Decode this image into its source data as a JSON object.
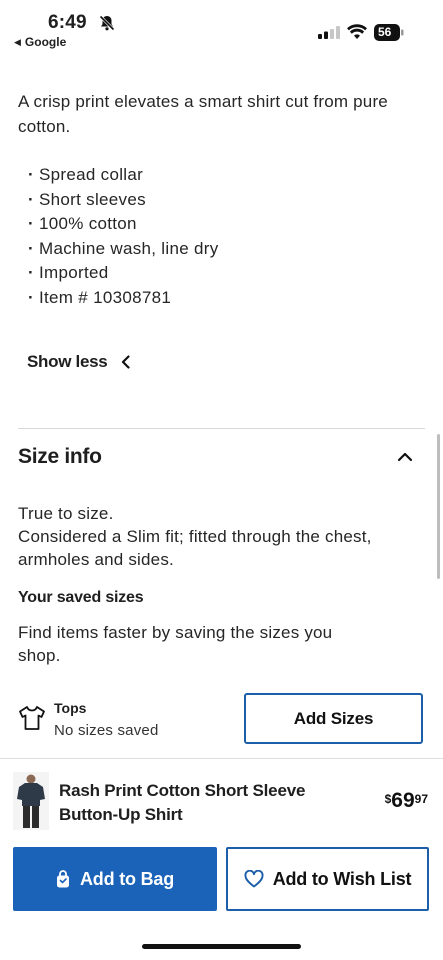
{
  "status_bar": {
    "time": "6:49",
    "back_app": "Google",
    "battery": "56"
  },
  "description": {
    "text": "A crisp print elevates a smart shirt cut from pure cotton.",
    "bullets": [
      "Spread collar",
      "Short sleeves",
      "100% cotton",
      "Machine wash, line dry",
      "Imported",
      "Item # 10308781"
    ],
    "show_less_label": "Show less"
  },
  "size_info": {
    "title": "Size info",
    "fit_line1": "True to size.",
    "fit_line2": "Considered a Slim fit; fitted through the chest, armholes and sides.",
    "saved_title": "Your saved sizes",
    "saved_desc": "Find items faster by saving the sizes you shop.",
    "category_label": "Tops",
    "category_status": "No sizes saved",
    "add_sizes_label": "Add Sizes"
  },
  "product_bar": {
    "name": "Rash Print Cotton Short Sleeve Button-Up Shirt",
    "price_currency": "$",
    "price_dollars": "69",
    "price_cents": "97",
    "add_to_bag_label": "Add to Bag",
    "add_to_wishlist_label": "Add to Wish List",
    "accent_color": "#1a63b9"
  }
}
